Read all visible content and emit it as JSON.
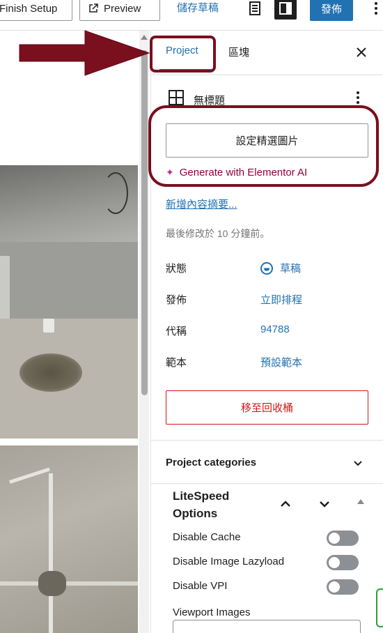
{
  "toolbar": {
    "finish_label": "Finish Setup",
    "preview_label": "Preview",
    "save_draft_label": "儲存草稿",
    "publish_label": "發佈"
  },
  "sidebar": {
    "tabs": [
      {
        "label": "Project",
        "active": true
      },
      {
        "label": "區塊",
        "active": false
      }
    ],
    "post_title": "無標題",
    "featured_image_button": "設定精選圖片",
    "generate_ai_link": "Generate with Elementor AI",
    "excerpt_link": "新增內容摘要...",
    "last_modified": "最後修改於 10 分鐘前。",
    "meta": [
      {
        "label": "狀態",
        "value": "草稿"
      },
      {
        "label": "發佈",
        "value": "立即排程"
      },
      {
        "label": "代稱",
        "value": "94788"
      },
      {
        "label": "範本",
        "value": "預設範本"
      }
    ],
    "trash_button": "移至回收桶",
    "categories_label": "Project categories",
    "litespeed": {
      "title": "LiteSpeed Options",
      "options": [
        {
          "label": "Disable Cache",
          "enabled": false
        },
        {
          "label": "Disable Image Lazyload",
          "enabled": false
        },
        {
          "label": "Disable VPI",
          "enabled": false
        }
      ],
      "viewport_label": "Viewport Images",
      "viewport_value": ""
    }
  },
  "colors": {
    "accent": "#2271b1",
    "danger": "#cc1818",
    "ai": "#93003c",
    "annotation": "#7a0f1e"
  }
}
